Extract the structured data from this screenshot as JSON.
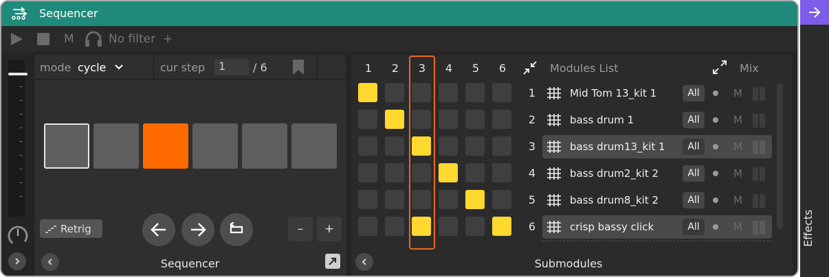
{
  "app": {
    "title": "Sequencer",
    "accent_color": "#208a7a",
    "effects_color": "#7c5ce8"
  },
  "toolbar": {
    "play_icon": "play-icon",
    "stop_icon": "stop-icon",
    "m_label": "M",
    "filter_label": "No filter",
    "add_label": "+"
  },
  "sequencer": {
    "mode_label": "mode",
    "mode_value": "cycle",
    "cur_step_label": "cur step",
    "cur_step_value": "1",
    "steps_total": "/ 6",
    "steps": [
      {
        "state": "current"
      },
      {
        "state": "off"
      },
      {
        "state": "active"
      },
      {
        "state": "off"
      },
      {
        "state": "off"
      },
      {
        "state": "off"
      }
    ],
    "retrig_label": "Retrig",
    "minus_label": "–",
    "plus_label": "+",
    "footer_label": "Sequencer"
  },
  "submodules": {
    "columns": [
      "1",
      "2",
      "3",
      "4",
      "5",
      "6"
    ],
    "highlight_column": 3,
    "grid": [
      [
        1,
        0,
        0,
        0,
        0,
        0
      ],
      [
        0,
        1,
        0,
        0,
        0,
        0
      ],
      [
        0,
        0,
        1,
        0,
        0,
        0
      ],
      [
        0,
        0,
        0,
        1,
        0,
        0
      ],
      [
        0,
        0,
        0,
        0,
        1,
        0
      ],
      [
        0,
        0,
        1,
        0,
        0,
        1
      ]
    ],
    "modules_list_label": "Modules List",
    "mix_label": "Mix",
    "modules": [
      {
        "num": "1",
        "name": "Mid Tom 13_kit 1",
        "all": "All",
        "m": "M",
        "highlighted": false
      },
      {
        "num": "2",
        "name": "bass drum 1",
        "all": "All",
        "m": "M",
        "highlighted": false
      },
      {
        "num": "3",
        "name": "bass drum13_kit 1",
        "all": "All",
        "m": "M",
        "highlighted": true
      },
      {
        "num": "4",
        "name": "bass drum2_kit 2",
        "all": "All",
        "m": "M",
        "highlighted": false
      },
      {
        "num": "5",
        "name": "bass drum8_kit 2",
        "all": "All",
        "m": "M",
        "highlighted": false
      },
      {
        "num": "6",
        "name": "crisp bassy click",
        "all": "All",
        "m": "M",
        "highlighted": true
      }
    ],
    "footer_label": "Submodules"
  },
  "effects": {
    "label": "Effects"
  }
}
